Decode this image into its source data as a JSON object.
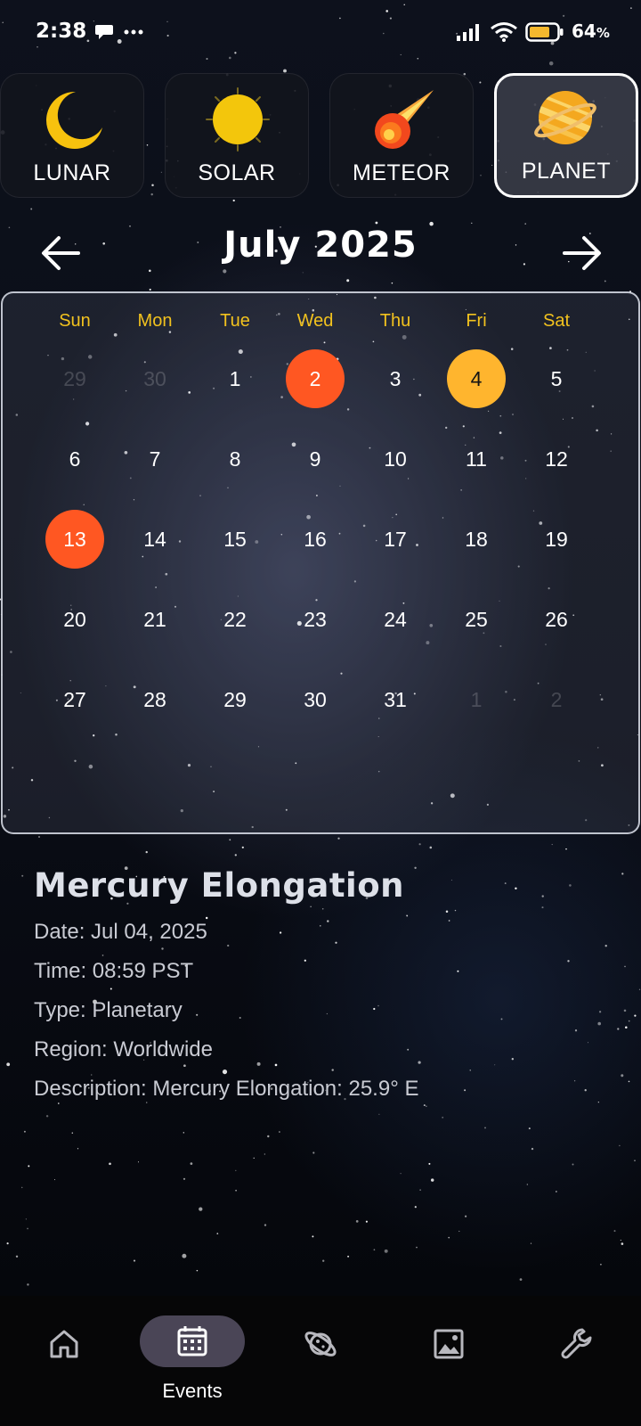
{
  "status_bar": {
    "time": "2:38",
    "battery": "64",
    "battery_unit": "%",
    "icons": [
      "chat-bubble-icon",
      "more-dots-icon",
      "signal-icon",
      "wifi-icon",
      "battery-icon"
    ]
  },
  "categories": [
    {
      "label": "LUNAR",
      "icon": "crescent-moon-icon",
      "selected": false
    },
    {
      "label": "SOLAR",
      "icon": "sun-icon",
      "selected": false
    },
    {
      "label": "METEOR",
      "icon": "comet-icon",
      "selected": false
    },
    {
      "label": "PLANET",
      "icon": "ringed-planet-icon",
      "selected": true
    }
  ],
  "calendar": {
    "month_title": "July 2025",
    "weekdays": [
      "Sun",
      "Mon",
      "Tue",
      "Wed",
      "Thu",
      "Fri",
      "Sat"
    ],
    "weeks": [
      [
        {
          "d": "29",
          "other": true
        },
        {
          "d": "30",
          "other": true
        },
        {
          "d": "1"
        },
        {
          "d": "2",
          "mark": "red"
        },
        {
          "d": "3"
        },
        {
          "d": "4",
          "mark": "gold"
        },
        {
          "d": "5"
        }
      ],
      [
        {
          "d": "6"
        },
        {
          "d": "7"
        },
        {
          "d": "8"
        },
        {
          "d": "9"
        },
        {
          "d": "10"
        },
        {
          "d": "11"
        },
        {
          "d": "12"
        }
      ],
      [
        {
          "d": "13",
          "mark": "red"
        },
        {
          "d": "14"
        },
        {
          "d": "15"
        },
        {
          "d": "16"
        },
        {
          "d": "17"
        },
        {
          "d": "18"
        },
        {
          "d": "19"
        }
      ],
      [
        {
          "d": "20"
        },
        {
          "d": "21"
        },
        {
          "d": "22"
        },
        {
          "d": "23"
        },
        {
          "d": "24"
        },
        {
          "d": "25"
        },
        {
          "d": "26"
        }
      ],
      [
        {
          "d": "27"
        },
        {
          "d": "28"
        },
        {
          "d": "29"
        },
        {
          "d": "30"
        },
        {
          "d": "31"
        },
        {
          "d": "1",
          "other": true
        },
        {
          "d": "2",
          "other": true
        }
      ]
    ],
    "colors": {
      "weekday": "#f2c21e",
      "event_red": "#ff5722",
      "selected_gold": "#ffb52e"
    }
  },
  "event": {
    "title": "Mercury Elongation",
    "date": "Date: Jul 04, 2025",
    "time": "Time: 08:59 PST",
    "type": "Type: Planetary",
    "region": "Region: Worldwide",
    "description": "Description: Mercury Elongation: 25.9° E"
  },
  "bottom_nav": {
    "items": [
      {
        "icon": "home-icon",
        "label": ""
      },
      {
        "icon": "calendar-icon",
        "label": "Events",
        "active": true
      },
      {
        "icon": "planet-orbit-icon",
        "label": ""
      },
      {
        "icon": "image-icon",
        "label": ""
      },
      {
        "icon": "wrench-icon",
        "label": ""
      }
    ]
  }
}
